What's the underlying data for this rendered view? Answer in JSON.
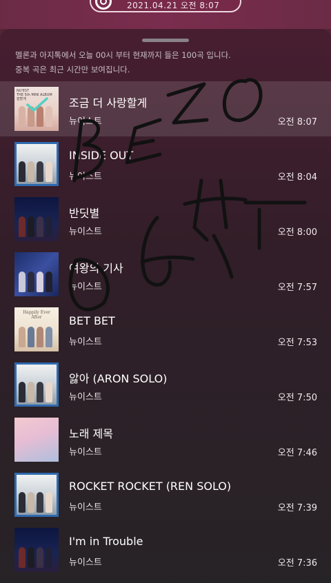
{
  "header": {
    "datetime": "2021.04.21 오전 8:07"
  },
  "notice": {
    "line1": "멜론과 아지톡에서 오늘 00시 부터 현재까지 들은 100곡 입니다.",
    "line2": "중복 곡은 최근 시간만 보여집니다."
  },
  "album_art_text": {
    "nuest_label": "NU'EST",
    "mini_album": "THE 5th MINI ALBUM",
    "album_title": "잘할게",
    "happily": "Happily Ever After"
  },
  "songs": [
    {
      "title": "조금 더 사랑할게",
      "artist": "뉴이스트",
      "time": "오전 8:07",
      "cover": "c1",
      "active": true
    },
    {
      "title": "INSIDE OUT",
      "artist": "뉴이스트",
      "time": "오전 8:04",
      "cover": "c2"
    },
    {
      "title": "반딧별",
      "artist": "뉴이스트",
      "time": "오전 8:00",
      "cover": "c3"
    },
    {
      "title": "여왕의 기사",
      "artist": "뉴이스트",
      "time": "오전 7:57",
      "cover": "c4"
    },
    {
      "title": "BET BET",
      "artist": "뉴이스트",
      "time": "오전 7:53",
      "cover": "c5"
    },
    {
      "title": "앓아 (ARON SOLO)",
      "artist": "뉴이스트",
      "time": "오전 7:50",
      "cover": "c2"
    },
    {
      "title": "노래 제목",
      "artist": "뉴이스트",
      "time": "오전 7:46",
      "cover": "c6"
    },
    {
      "title": "ROCKET ROCKET (REN SOLO)",
      "artist": "뉴이스트",
      "time": "오전 7:39",
      "cover": "c2"
    },
    {
      "title": "I'm in Trouble",
      "artist": "뉴이스트",
      "time": "오전 7:36",
      "cover": "c3"
    }
  ],
  "colors": {
    "accent": "#7a2d4e",
    "check": "#4fd1c5",
    "scribble": "#111111"
  },
  "icons": [
    "record-icon",
    "check-icon"
  ]
}
